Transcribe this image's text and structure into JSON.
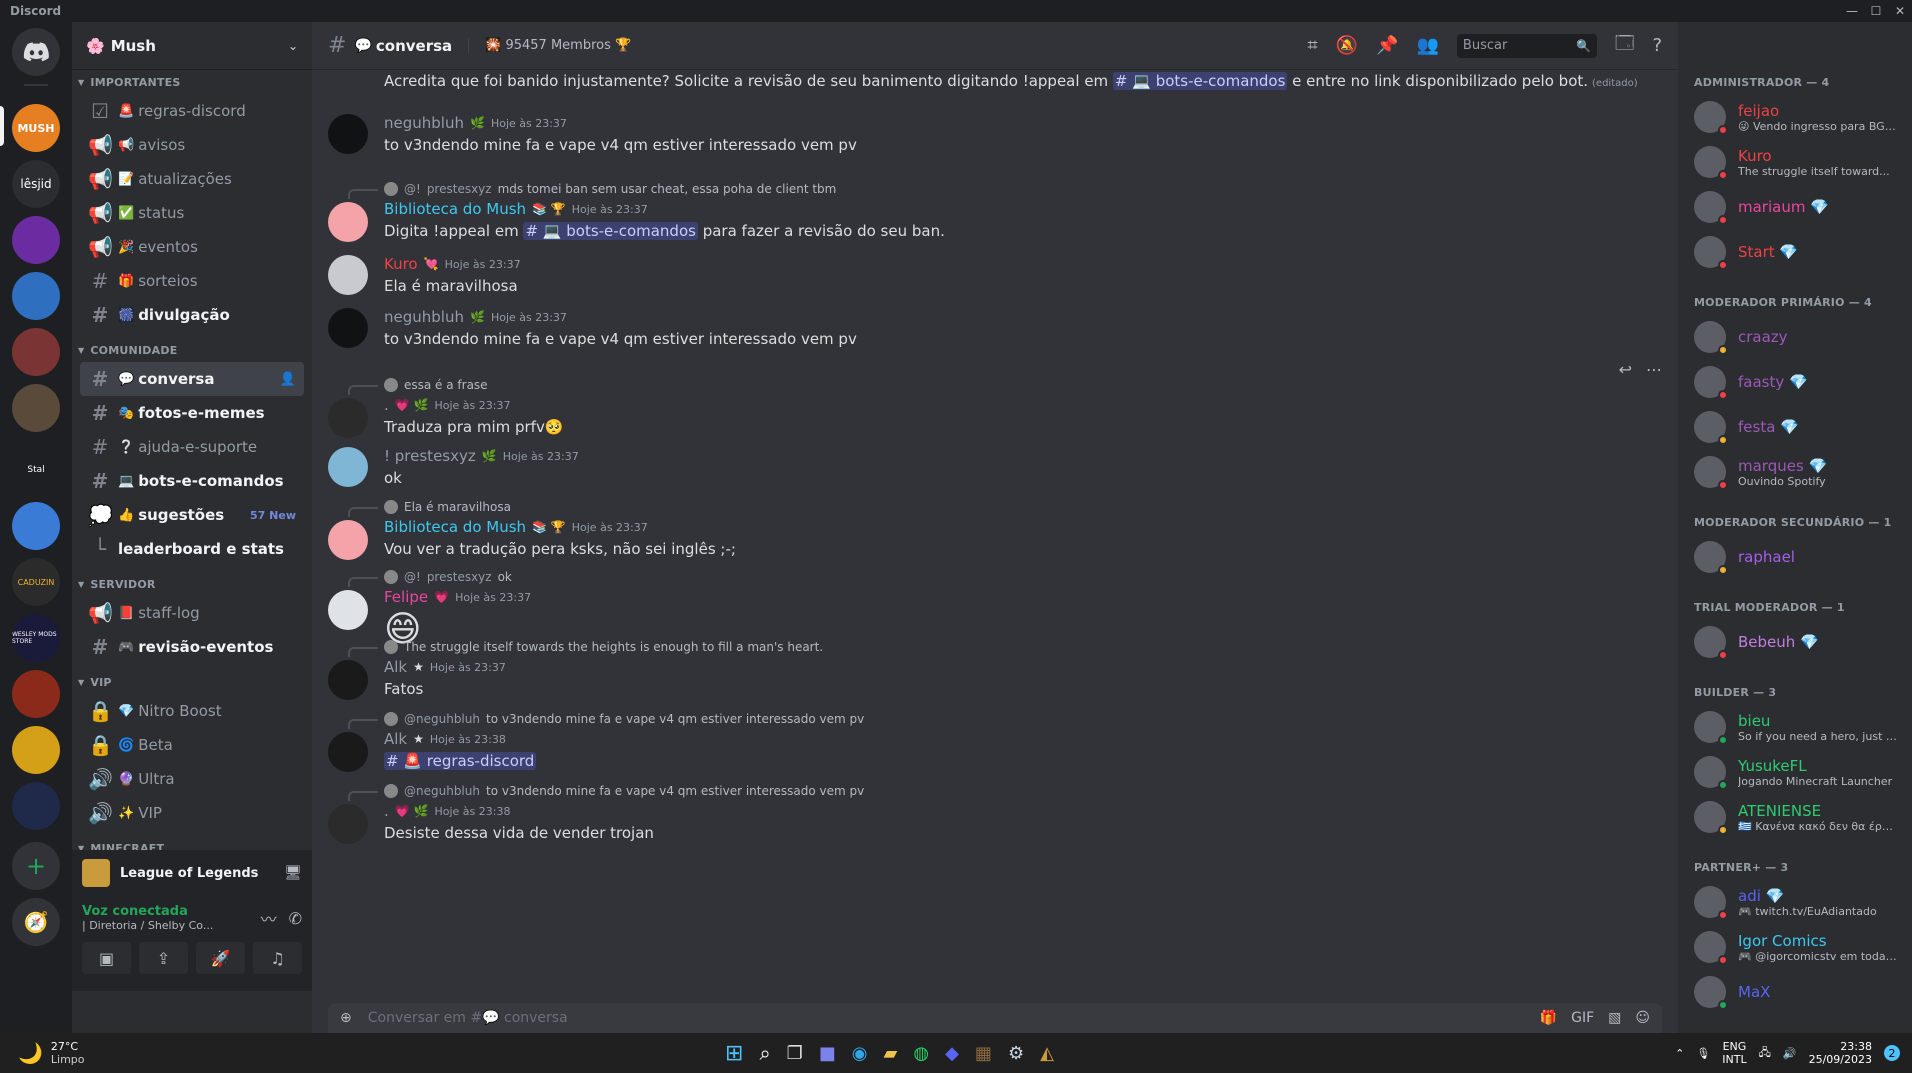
{
  "window": {
    "title": "Discord",
    "controls": [
      "—",
      "☐",
      "✕"
    ]
  },
  "guild_list": {
    "home_label": "Discord",
    "items": [
      "MUSH",
      "lêsjid",
      "Guild",
      "Mush",
      "Avatar",
      "Server",
      "Stal",
      "Server",
      "CADUZIN",
      "WESLEY MODS STORE",
      "Guild",
      "Guild",
      "Guild"
    ],
    "add_server": "+",
    "explore": "explore"
  },
  "server": {
    "name": "Mush",
    "categories": [
      {
        "name": "IMPORTANTES",
        "channels": [
          {
            "name": "regras-discord",
            "emoji": "🚨",
            "icon": "rules-icon",
            "unread": false
          },
          {
            "name": "avisos",
            "emoji": "📢",
            "icon": "announcement-icon",
            "unread": false
          },
          {
            "name": "atualizações",
            "emoji": "📝",
            "icon": "announcement-icon",
            "unread": false
          },
          {
            "name": "status",
            "emoji": "✅",
            "icon": "announcement-icon",
            "unread": false
          },
          {
            "name": "eventos",
            "emoji": "🎉",
            "icon": "announcement-icon",
            "unread": false
          },
          {
            "name": "sorteios",
            "emoji": "🎁",
            "icon": "hash-icon",
            "unread": false
          },
          {
            "name": "divulgação",
            "emoji": "🎆",
            "icon": "hash-icon",
            "unread": true
          }
        ]
      },
      {
        "name": "COMUNIDADE",
        "channels": [
          {
            "name": "conversa",
            "emoji": "💬",
            "icon": "hash-icon",
            "unread": true,
            "active": true
          },
          {
            "name": "fotos-e-memes",
            "emoji": "🎭",
            "icon": "hash-icon",
            "unread": true
          },
          {
            "name": "ajuda-e-suporte",
            "emoji": "❔",
            "icon": "hash-icon",
            "unread": false
          },
          {
            "name": "bots-e-comandos",
            "emoji": "💻",
            "icon": "hash-icon",
            "unread": true
          },
          {
            "name": "sugestões",
            "emoji": "👍",
            "icon": "forum-icon",
            "unread": true,
            "badge": "57 New"
          },
          {
            "name": "leaderboard e stats",
            "emoji": "",
            "icon": "thread-icon",
            "unread": true
          }
        ]
      },
      {
        "name": "SERVIDOR",
        "channels": [
          {
            "name": "staff-log",
            "emoji": "📕",
            "icon": "announcement-icon",
            "unread": false
          },
          {
            "name": "revisão-eventos",
            "emoji": "🎮",
            "icon": "hash-icon",
            "unread": true
          }
        ]
      },
      {
        "name": "VIP",
        "channels": [
          {
            "name": "Nitro Boost",
            "emoji": "💎",
            "icon": "lock-icon",
            "unread": false
          },
          {
            "name": "Beta",
            "emoji": "🌀",
            "icon": "lock-icon",
            "unread": false
          },
          {
            "name": "Ultra",
            "emoji": "🔮",
            "icon": "voice-icon",
            "unread": false
          },
          {
            "name": "VIP",
            "emoji": "✨",
            "icon": "voice-icon",
            "unread": false
          }
        ]
      },
      {
        "name": "MINECRAFT",
        "channels": []
      }
    ]
  },
  "game_activity": {
    "name": "League of Legends"
  },
  "voice": {
    "status": "Voz conectada",
    "channel": "| Diretoria / Shelby Co..."
  },
  "chat": {
    "channel": "conversa",
    "channel_emoji": "💬",
    "topic": "🎇 95457 Membros 🏆",
    "search_placeholder": "Buscar",
    "composer_placeholder": "Conversar em #💬 conversa"
  },
  "messages": [
    {
      "kind": "cont",
      "text": "Acredita que foi banido injustamente? Solicite a revisão de seu banimento digitando !appeal em ",
      "mention": "# 💻 bots-e-comandos",
      "text_after": " e entre no link disponibilizado pelo bot.",
      "edited": "(editado)"
    },
    {
      "kind": "full",
      "user": "neguhbluh",
      "color": "#949ba4",
      "badge": "🌿",
      "time": "Hoje às 23:37",
      "text": "to v3ndendo mine fa e vape v4 qm estiver interessado vem pv",
      "avatar": "#111214"
    },
    {
      "kind": "full",
      "reply": {
        "user": "@!",
        "name": "prestesxyz",
        "text": "mds tomei ban sem usar cheat, essa poha de client tbm"
      },
      "user": "Biblioteca do Mush",
      "color": "#3ec8f0",
      "badge": "📚 🏆",
      "time": "Hoje às 23:37",
      "text": "Digita !appeal em ",
      "mention": "# 💻 bots-e-comandos",
      "text_after": " para fazer a revisão do seu ban.",
      "avatar": "#f4a3a8"
    },
    {
      "kind": "full",
      "user": "Kuro",
      "color": "#ed4245",
      "badge": "💘",
      "time": "Hoje às 23:37",
      "text": "Ela é maravilhosa",
      "avatar": "#c9c9d0"
    },
    {
      "kind": "full",
      "user": "neguhbluh",
      "color": "#949ba4",
      "badge": "🌿",
      "time": "Hoje às 23:37",
      "text": "to v3ndendo mine fa e vape v4 qm estiver interessado vem pv",
      "avatar": "#111214"
    },
    {
      "kind": "full",
      "reply": {
        "user": "",
        "name": "",
        "text": "essa é a frase"
      },
      "user": ".",
      "color": "#949ba4",
      "badge": "💗 🌿",
      "time": "Hoje às 23:37",
      "text": "Traduza pra mim prfv🥺",
      "avatar": "#2b2b2b"
    },
    {
      "kind": "full",
      "user": "!   prestesxyz",
      "color": "#949ba4",
      "badge": "🌿",
      "time": "Hoje às 23:37",
      "text": "ok",
      "avatar": "#7fb6d5"
    },
    {
      "kind": "full",
      "reply": {
        "user": "",
        "name": "",
        "text": "Ela é maravilhosa"
      },
      "user": "Biblioteca do Mush",
      "color": "#3ec8f0",
      "badge": "📚 🏆",
      "time": "Hoje às 23:37",
      "text": "Vou ver a tradução pera ksks, não sei inglês ;-;",
      "avatar": "#f4a3a8"
    },
    {
      "kind": "full",
      "reply": {
        "user": "@!",
        "name": "prestesxyz",
        "text": "ok"
      },
      "user": "Felipe",
      "color": "#eb459e",
      "badge": "💗",
      "time": "Hoje às 23:37",
      "text": "😄",
      "big": true,
      "avatar": "#dfe3e8"
    },
    {
      "kind": "full",
      "reply": {
        "user": "",
        "name": "",
        "text": "The struggle itself towards the heights is enough to fill a man's heart."
      },
      "user": "Alk",
      "color": "#949ba4",
      "badge": "★",
      "time": "Hoje às 23:37",
      "text": "Fatos",
      "avatar": "#1a1a1a"
    },
    {
      "kind": "full",
      "reply": {
        "user": "@neguhbluh",
        "name": "",
        "text": "to v3ndendo mine fa e vape v4 qm estiver interessado vem pv"
      },
      "user": "Alk",
      "color": "#949ba4",
      "badge": "★",
      "time": "Hoje às 23:38",
      "text": "",
      "mention": "# 🚨 regras-discord",
      "text_after": "",
      "avatar": "#1a1a1a"
    },
    {
      "kind": "full",
      "reply": {
        "user": "@neguhbluh",
        "name": "",
        "text": "to v3ndendo mine fa e vape v4 qm estiver interessado vem pv"
      },
      "user": ".",
      "color": "#949ba4",
      "badge": "💗 🌿",
      "time": "Hoje às 23:38",
      "text": "Desiste dessa vida de vender trojan",
      "avatar": "#2b2b2b"
    }
  ],
  "members": {
    "groups": [
      {
        "title": "ADMINISTRADOR — 4",
        "members": [
          {
            "name": "feijao",
            "color": "#ed4245",
            "activity": "😜 Vendo ingresso para BGS ...",
            "status": "#f23f43"
          },
          {
            "name": "Kuro",
            "color": "#ed4245",
            "activity": "The struggle itself toward...",
            "status": "#f23f43"
          },
          {
            "name": "mariaum 💎",
            "color": "#eb459e",
            "activity": "",
            "status": "#f23f43"
          },
          {
            "name": "Start 💎",
            "color": "#ed4245",
            "activity": "",
            "status": "#f23f43"
          }
        ]
      },
      {
        "title": "MODERADOR PRIMÁRIO — 4",
        "members": [
          {
            "name": "craazy",
            "color": "#9b59b6",
            "activity": "",
            "status": "#f0b232"
          },
          {
            "name": "faasty 💎",
            "color": "#9b59b6",
            "activity": "",
            "status": "#f23f43"
          },
          {
            "name": "festa 💎",
            "color": "#9b59b6",
            "activity": "",
            "status": "#f0b232"
          },
          {
            "name": "marques 💎",
            "color": "#9b59b6",
            "activity": "Ouvindo Spotify",
            "status": "#f23f43"
          }
        ]
      },
      {
        "title": "MODERADOR SECUNDÁRIO — 1",
        "members": [
          {
            "name": "raphael",
            "color": "#a55eea",
            "activity": "",
            "status": "#f0b232"
          }
        ]
      },
      {
        "title": "TRIAL MODERADOR — 1",
        "members": [
          {
            "name": "Bebeuh 💎",
            "color": "#c27ce2",
            "activity": "",
            "status": "#f23f43"
          }
        ]
      },
      {
        "title": "BUILDER — 3",
        "members": [
          {
            "name": "bieu",
            "color": "#2ecc71",
            "activity": "So if you need a hero, just loo...",
            "status": "#23a55a"
          },
          {
            "name": "YusukeFL",
            "color": "#2ecc71",
            "activity": "Jogando Minecraft Launcher",
            "status": "#23a55a"
          },
          {
            "name": "ATENIENSE",
            "color": "#2ecc71",
            "activity": "🇬🇷 Κανένα κακό δεν θα έρθει ...",
            "status": "#f0b232"
          }
        ]
      },
      {
        "title": "PARTNER+ — 3",
        "members": [
          {
            "name": "adi 💎",
            "color": "#5865f2",
            "activity": "🎮 twitch.tv/EuAdiantado",
            "status": "#f23f43"
          },
          {
            "name": "Igor Comics",
            "color": "#3ec8f0",
            "activity": "🎮 @igorcomicstv em todas a...",
            "status": "#f23f43"
          },
          {
            "name": "MaX",
            "color": "#5865f2",
            "activity": "",
            "status": "#23a55a"
          }
        ]
      }
    ]
  },
  "taskbar": {
    "weather_temp": "27°C",
    "weather_desc": "Limpo",
    "lang": "ENG",
    "layout": "INTL",
    "time": "23:38",
    "date": "25/09/2023",
    "notif": "2"
  }
}
